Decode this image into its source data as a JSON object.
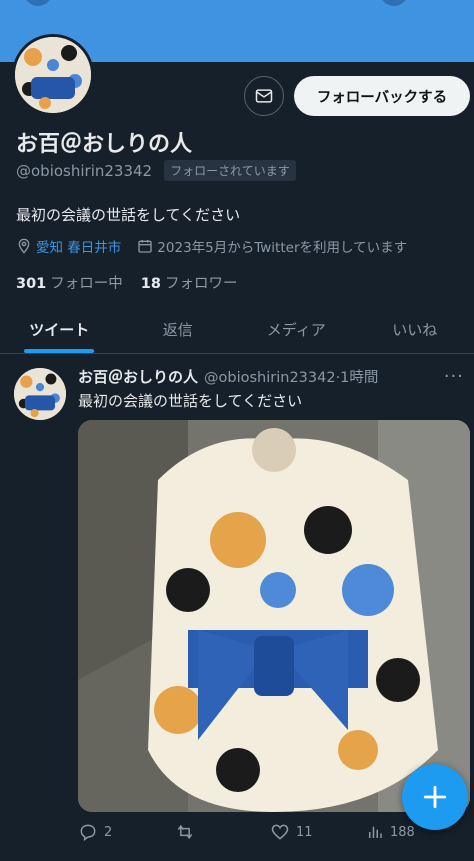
{
  "profile": {
    "display_name": "お百＠おしりの人",
    "handle": "@obioshirin23342",
    "follows_you": "フォローされています",
    "bio": "最初の会議の世話をしてください",
    "location": "愛知 春日井市",
    "joined": "2023年5月からTwitterを利用しています",
    "following_count": "301",
    "following_label": "フォロー中",
    "followers_count": "18",
    "followers_label": "フォロワー"
  },
  "buttons": {
    "message_icon": "envelope-icon",
    "follow_back": "フォローバックする"
  },
  "tabs": [
    {
      "label": "ツイート",
      "active": true
    },
    {
      "label": "返信",
      "active": false
    },
    {
      "label": "メディア",
      "active": false
    },
    {
      "label": "いいね",
      "active": false
    }
  ],
  "tweet": {
    "name": "お百＠おしりの人",
    "handle": "@obioshirin23342",
    "time": "·1時間",
    "text": "最初の会議の世話をしてください",
    "replies": "2",
    "retweets": "",
    "likes": "11",
    "views": "188"
  },
  "colors": {
    "background": "#15202b",
    "banner": "#3f93e0",
    "accent": "#1d9bf0",
    "muted": "#8b98a5"
  }
}
